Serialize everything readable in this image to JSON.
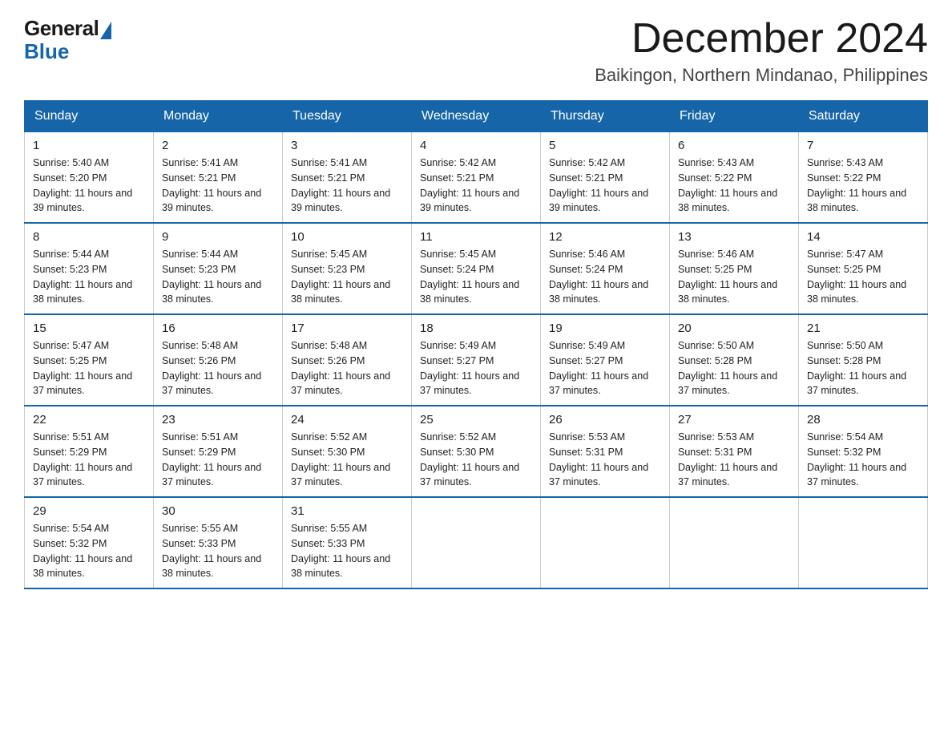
{
  "logo": {
    "general": "General",
    "blue": "Blue"
  },
  "header": {
    "month_title": "December 2024",
    "location": "Baikingon, Northern Mindanao, Philippines"
  },
  "days_of_week": [
    "Sunday",
    "Monday",
    "Tuesday",
    "Wednesday",
    "Thursday",
    "Friday",
    "Saturday"
  ],
  "weeks": [
    [
      {
        "day": "1",
        "sunrise": "5:40 AM",
        "sunset": "5:20 PM",
        "daylight": "11 hours and 39 minutes."
      },
      {
        "day": "2",
        "sunrise": "5:41 AM",
        "sunset": "5:21 PM",
        "daylight": "11 hours and 39 minutes."
      },
      {
        "day": "3",
        "sunrise": "5:41 AM",
        "sunset": "5:21 PM",
        "daylight": "11 hours and 39 minutes."
      },
      {
        "day": "4",
        "sunrise": "5:42 AM",
        "sunset": "5:21 PM",
        "daylight": "11 hours and 39 minutes."
      },
      {
        "day": "5",
        "sunrise": "5:42 AM",
        "sunset": "5:21 PM",
        "daylight": "11 hours and 39 minutes."
      },
      {
        "day": "6",
        "sunrise": "5:43 AM",
        "sunset": "5:22 PM",
        "daylight": "11 hours and 38 minutes."
      },
      {
        "day": "7",
        "sunrise": "5:43 AM",
        "sunset": "5:22 PM",
        "daylight": "11 hours and 38 minutes."
      }
    ],
    [
      {
        "day": "8",
        "sunrise": "5:44 AM",
        "sunset": "5:23 PM",
        "daylight": "11 hours and 38 minutes."
      },
      {
        "day": "9",
        "sunrise": "5:44 AM",
        "sunset": "5:23 PM",
        "daylight": "11 hours and 38 minutes."
      },
      {
        "day": "10",
        "sunrise": "5:45 AM",
        "sunset": "5:23 PM",
        "daylight": "11 hours and 38 minutes."
      },
      {
        "day": "11",
        "sunrise": "5:45 AM",
        "sunset": "5:24 PM",
        "daylight": "11 hours and 38 minutes."
      },
      {
        "day": "12",
        "sunrise": "5:46 AM",
        "sunset": "5:24 PM",
        "daylight": "11 hours and 38 minutes."
      },
      {
        "day": "13",
        "sunrise": "5:46 AM",
        "sunset": "5:25 PM",
        "daylight": "11 hours and 38 minutes."
      },
      {
        "day": "14",
        "sunrise": "5:47 AM",
        "sunset": "5:25 PM",
        "daylight": "11 hours and 38 minutes."
      }
    ],
    [
      {
        "day": "15",
        "sunrise": "5:47 AM",
        "sunset": "5:25 PM",
        "daylight": "11 hours and 37 minutes."
      },
      {
        "day": "16",
        "sunrise": "5:48 AM",
        "sunset": "5:26 PM",
        "daylight": "11 hours and 37 minutes."
      },
      {
        "day": "17",
        "sunrise": "5:48 AM",
        "sunset": "5:26 PM",
        "daylight": "11 hours and 37 minutes."
      },
      {
        "day": "18",
        "sunrise": "5:49 AM",
        "sunset": "5:27 PM",
        "daylight": "11 hours and 37 minutes."
      },
      {
        "day": "19",
        "sunrise": "5:49 AM",
        "sunset": "5:27 PM",
        "daylight": "11 hours and 37 minutes."
      },
      {
        "day": "20",
        "sunrise": "5:50 AM",
        "sunset": "5:28 PM",
        "daylight": "11 hours and 37 minutes."
      },
      {
        "day": "21",
        "sunrise": "5:50 AM",
        "sunset": "5:28 PM",
        "daylight": "11 hours and 37 minutes."
      }
    ],
    [
      {
        "day": "22",
        "sunrise": "5:51 AM",
        "sunset": "5:29 PM",
        "daylight": "11 hours and 37 minutes."
      },
      {
        "day": "23",
        "sunrise": "5:51 AM",
        "sunset": "5:29 PM",
        "daylight": "11 hours and 37 minutes."
      },
      {
        "day": "24",
        "sunrise": "5:52 AM",
        "sunset": "5:30 PM",
        "daylight": "11 hours and 37 minutes."
      },
      {
        "day": "25",
        "sunrise": "5:52 AM",
        "sunset": "5:30 PM",
        "daylight": "11 hours and 37 minutes."
      },
      {
        "day": "26",
        "sunrise": "5:53 AM",
        "sunset": "5:31 PM",
        "daylight": "11 hours and 37 minutes."
      },
      {
        "day": "27",
        "sunrise": "5:53 AM",
        "sunset": "5:31 PM",
        "daylight": "11 hours and 37 minutes."
      },
      {
        "day": "28",
        "sunrise": "5:54 AM",
        "sunset": "5:32 PM",
        "daylight": "11 hours and 37 minutes."
      }
    ],
    [
      {
        "day": "29",
        "sunrise": "5:54 AM",
        "sunset": "5:32 PM",
        "daylight": "11 hours and 38 minutes."
      },
      {
        "day": "30",
        "sunrise": "5:55 AM",
        "sunset": "5:33 PM",
        "daylight": "11 hours and 38 minutes."
      },
      {
        "day": "31",
        "sunrise": "5:55 AM",
        "sunset": "5:33 PM",
        "daylight": "11 hours and 38 minutes."
      },
      null,
      null,
      null,
      null
    ]
  ]
}
